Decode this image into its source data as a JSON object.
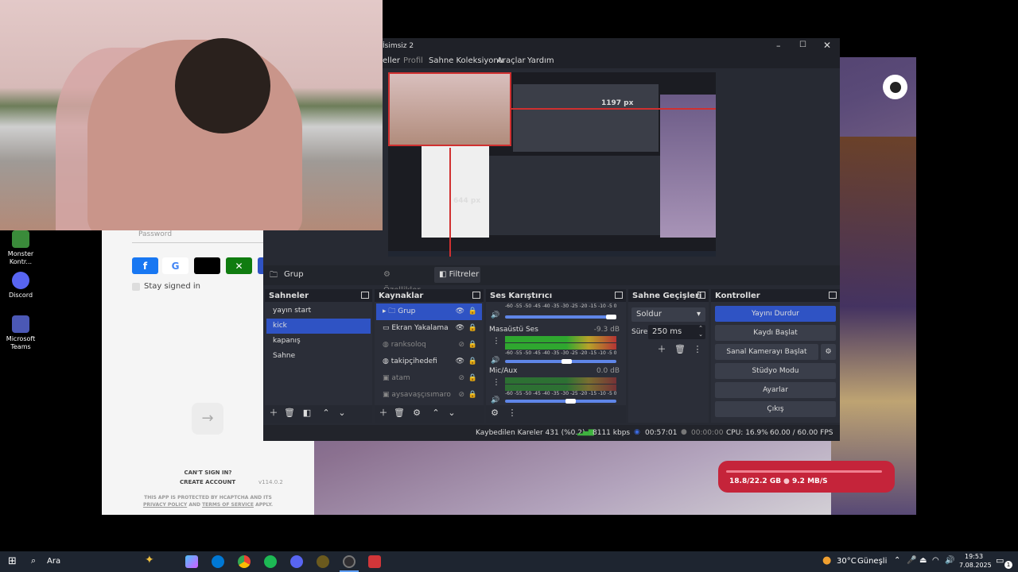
{
  "desktop": {
    "icons": [
      {
        "label": "Monster Kontr...",
        "color": "#3a8b3a"
      },
      {
        "label": "Discord",
        "color": "#5865F2"
      },
      {
        "label": "Microsoft Teams",
        "color": "#4b58b5"
      }
    ]
  },
  "login": {
    "password_placeholder": "Password",
    "stay_signed": "Stay signed in",
    "cant_sign": "CAN'T SIGN IN?",
    "create": "CREATE ACCOUNT",
    "version": "v114.0.2",
    "hcaptcha": "THIS APP IS PROTECTED BY HCAPTCHA AND ITS",
    "privacy": "PRIVACY POLICY",
    "and": "AND",
    "terms": "TERMS OF SERVICE",
    "apply": "APPLY."
  },
  "game": {
    "storage": "18.8/22.2 GB",
    "speed": "9.2 MB/S"
  },
  "obs": {
    "title": "İsimsiz 2",
    "menu": [
      "eller",
      "Profil",
      "Sahne Koleksiyonu",
      "Araçlar",
      "Yardım"
    ],
    "preview": {
      "width_label": "1197 px",
      "height_label": "644 px"
    },
    "source_bar": {
      "name": "Grup",
      "props": "Özellikler",
      "filters": "Filtreler"
    },
    "scenes": {
      "title": "Sahneler",
      "items": [
        "yayın start",
        "kick",
        "kapanış",
        "Sahne"
      ],
      "selected": 1
    },
    "sources": {
      "title": "Kaynaklar",
      "items": [
        "Grup",
        "Ekran Yakalama",
        "ranksoloq",
        "takipçihedefi",
        "atam",
        "aysavaşçısımaro"
      ],
      "selected": 0
    },
    "mixer": {
      "title": "Ses Karıştırıcı",
      "scale": "-60 -55 -50 -45 -40 -35 -30 -25 -20 -15 -10 -5 0",
      "channels": [
        {
          "name": "Masaüstü Ses",
          "db": "-9.3 dB",
          "level": 0.56
        },
        {
          "name": "Mic/Aux",
          "db": "0.0 dB",
          "level": 0.6
        }
      ]
    },
    "transitions": {
      "title": "Sahne Geçişleri",
      "type": "Soldur",
      "duration_label": "Süre",
      "duration": "250 ms"
    },
    "controls": {
      "title": "Kontroller",
      "buttons": [
        "Yayını Durdur",
        "Kaydı Başlat",
        "Sanal Kamerayı Başlat",
        "Stüdyo Modu",
        "Ayarlar",
        "Çıkış"
      ]
    },
    "status": {
      "dropped": "Kaybedilen Kareler 431 (%0.2)",
      "bitrate": "8111 kbps",
      "live_time": "00:57:01",
      "rec_time": "00:00:00",
      "cpu": "CPU: 16.9%",
      "fps": "60.00 / 60.00 FPS"
    }
  },
  "taskbar": {
    "search": "Ara",
    "weather": "30°C",
    "weather_text": "Güneşli",
    "time": "19:53",
    "date": "7.08.2025",
    "notif": "1"
  },
  "colors": {
    "accent": "#2f53c4",
    "live": "#3b6ae0",
    "storage": "#c5243a"
  }
}
